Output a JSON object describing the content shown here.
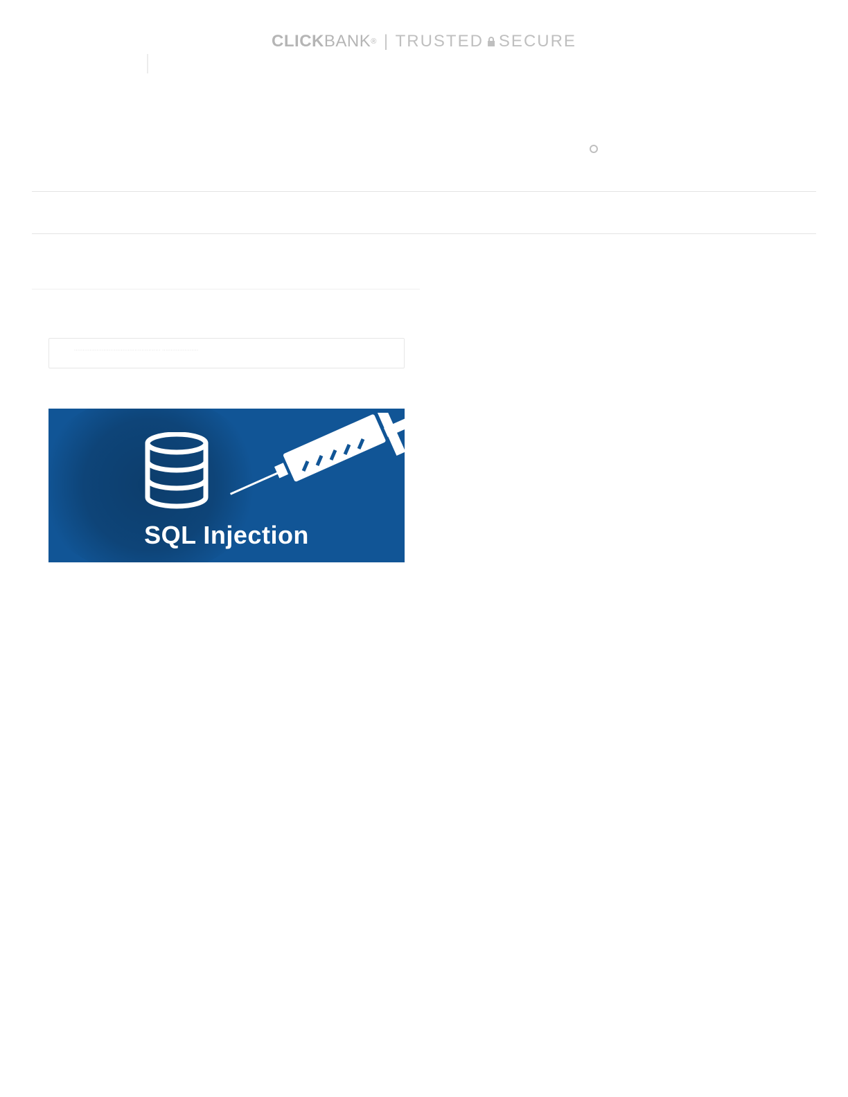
{
  "header": {
    "brand_click": "CLICK",
    "brand_bank": "BANK",
    "brand_registered": "®",
    "separator": "|",
    "trusted": "TRUSTED",
    "secure": "SECURE"
  },
  "card": {
    "tiny_text": "·················································· ·····················"
  },
  "banner": {
    "label": "SQL Injection",
    "icon_db": "database-icon",
    "icon_syringe": "syringe-icon",
    "bg_color": "#115596"
  }
}
